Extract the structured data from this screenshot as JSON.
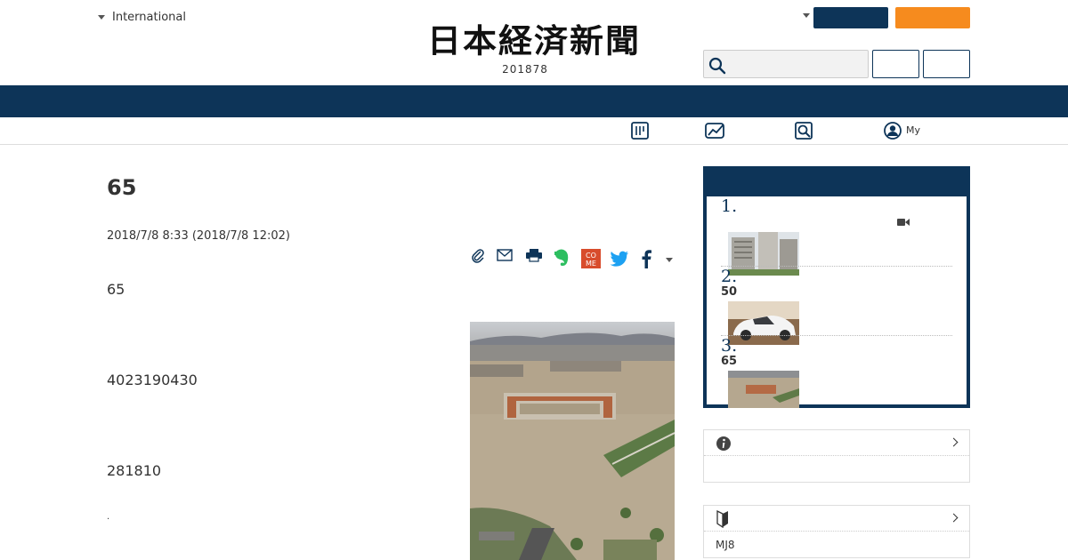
{
  "header": {
    "edition_label": "International",
    "logo_text": "日本経済新聞",
    "date_number": "201878"
  },
  "colors": {
    "navy": "#0d3458",
    "orange": "#f68b1e"
  },
  "subnav": {
    "my_label": "My"
  },
  "article": {
    "title": "65",
    "timestamp": "2018/7/8 8:33 (2018/7/8 12:02)",
    "paragraphs": [
      "65",
      "4023190430",
      "281810",
      "."
    ]
  },
  "share_icons": [
    "clip-icon",
    "mail-icon",
    "print-icon",
    "evernote-icon",
    "come-icon",
    "twitter-icon",
    "facebook-icon",
    "chevron-down-icon"
  ],
  "ranking": {
    "items": [
      {
        "rank": "1.",
        "sub": "",
        "has_video": true
      },
      {
        "rank": "2.",
        "sub": "50",
        "has_video": false
      },
      {
        "rank": "3.",
        "sub": "65",
        "has_video": false
      }
    ]
  },
  "panels": {
    "panel2_text": "MJ8"
  }
}
